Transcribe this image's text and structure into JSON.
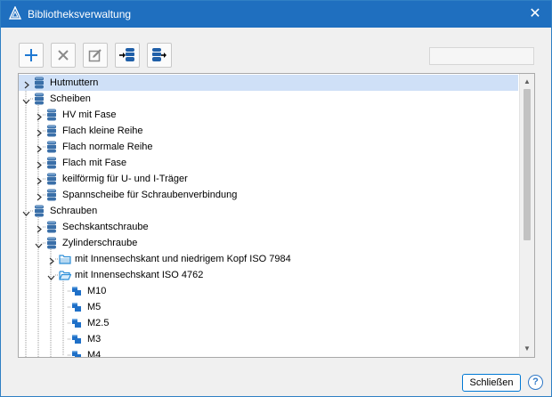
{
  "window": {
    "title": "Bibliotheksverwaltung",
    "close_glyph": "✕"
  },
  "toolbar": {
    "buttons": [
      {
        "name": "add-button",
        "icon": "plus-icon",
        "color": "#1e78d2"
      },
      {
        "name": "delete-button",
        "icon": "x-icon",
        "color": "#8a8a8a"
      },
      {
        "name": "edit-button",
        "icon": "edit-icon",
        "color": "#8a8a8a"
      },
      {
        "name": "import-button",
        "icon": "database-import-icon",
        "color": "#1f5fa8"
      },
      {
        "name": "export-button",
        "icon": "database-export-icon",
        "color": "#1f5fa8"
      }
    ]
  },
  "search": {
    "value": ""
  },
  "tree": {
    "rows": [
      {
        "label": "Hutmuttern",
        "level": 0,
        "expander": "collapsed",
        "icon": "database-icon",
        "selected": true
      },
      {
        "label": "Scheiben",
        "level": 0,
        "expander": "expanded",
        "icon": "database-icon"
      },
      {
        "label": "HV mit Fase",
        "level": 1,
        "expander": "collapsed",
        "icon": "database-icon"
      },
      {
        "label": "Flach kleine Reihe",
        "level": 1,
        "expander": "collapsed",
        "icon": "database-icon"
      },
      {
        "label": "Flach normale Reihe",
        "level": 1,
        "expander": "collapsed",
        "icon": "database-icon"
      },
      {
        "label": "Flach mit Fase",
        "level": 1,
        "expander": "collapsed",
        "icon": "database-icon"
      },
      {
        "label": "keilförmig für U- und I-Träger",
        "level": 1,
        "expander": "collapsed",
        "icon": "database-icon"
      },
      {
        "label": "Spannscheibe für Schraubenverbindung",
        "level": 1,
        "expander": "collapsed",
        "icon": "database-icon"
      },
      {
        "label": "Schrauben",
        "level": 0,
        "expander": "expanded",
        "icon": "database-icon"
      },
      {
        "label": "Sechskantschraube",
        "level": 1,
        "expander": "collapsed",
        "icon": "database-icon"
      },
      {
        "label": "Zylinderschraube",
        "level": 1,
        "expander": "expanded",
        "icon": "database-icon"
      },
      {
        "label": "mit Innensechskant und niedrigem Kopf ISO 7984",
        "level": 2,
        "expander": "collapsed",
        "icon": "folder-icon"
      },
      {
        "label": "mit Innensechskant ISO 4762",
        "level": 2,
        "expander": "expanded",
        "icon": "folder-open-icon"
      },
      {
        "label": "M10",
        "level": 3,
        "expander": "none",
        "icon": "part-icon"
      },
      {
        "label": "M5",
        "level": 3,
        "expander": "none",
        "icon": "part-icon"
      },
      {
        "label": "M2.5",
        "level": 3,
        "expander": "none",
        "icon": "part-icon"
      },
      {
        "label": "M3",
        "level": 3,
        "expander": "none",
        "icon": "part-icon"
      },
      {
        "label": "M4",
        "level": 3,
        "expander": "none",
        "icon": "part-icon"
      }
    ]
  },
  "scrollbar": {
    "up_glyph": "▲",
    "down_glyph": "▼"
  },
  "footer": {
    "close_label": "Schließen",
    "help_label": "?"
  },
  "colors": {
    "titlebar": "#1f6fbf",
    "selection": "#cfe0f7",
    "database_icon": "#3a6fa8",
    "folder_icon": "#2e8fd8",
    "part_icon": "#1f70c8"
  }
}
